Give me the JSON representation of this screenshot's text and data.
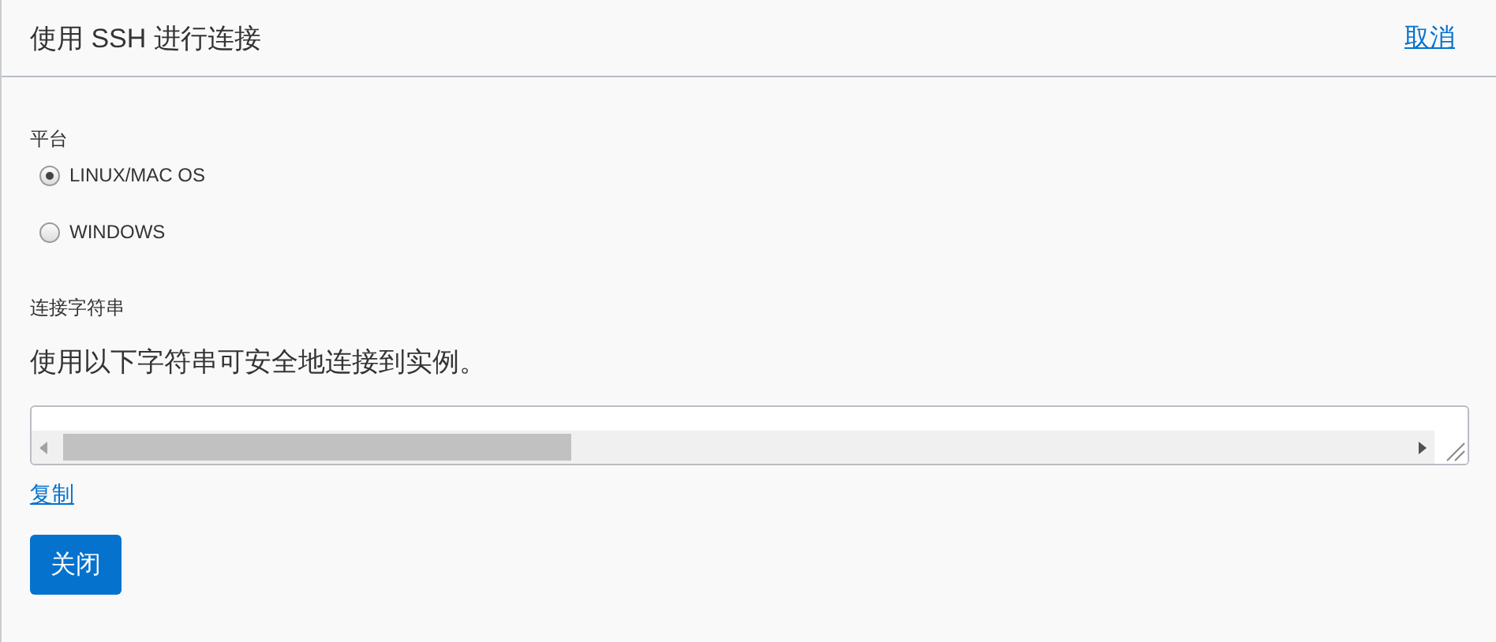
{
  "header": {
    "title": "使用 SSH 进行连接",
    "cancel_link": "取消"
  },
  "platform": {
    "label": "平台",
    "options": [
      {
        "label": "LINUX/MAC OS",
        "selected": true
      },
      {
        "label": "WINDOWS",
        "selected": false
      }
    ]
  },
  "connection_string": {
    "label": "连接字符串",
    "description": "使用以下字符串可安全地连接到实例。"
  },
  "copy_link": "复制",
  "close_button": "关闭"
}
